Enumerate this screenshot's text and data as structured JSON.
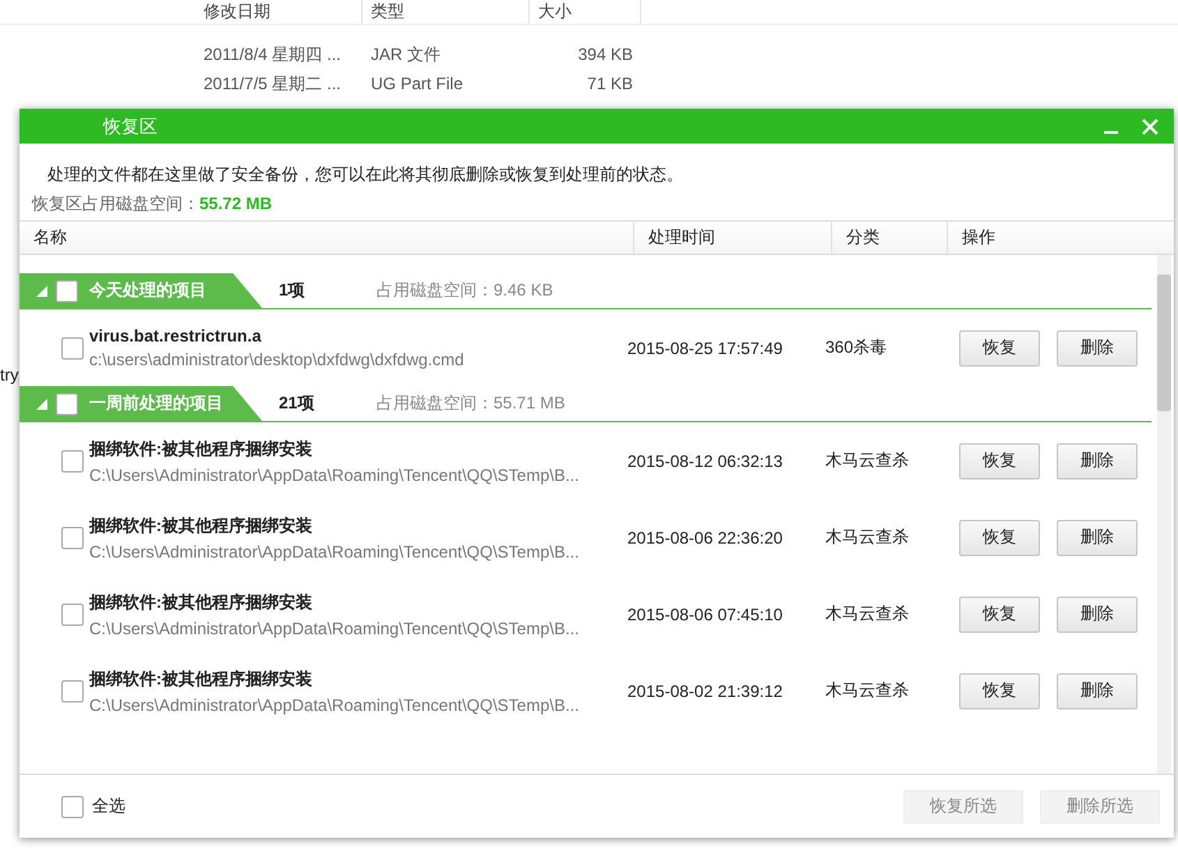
{
  "background_window": {
    "columns": [
      "修改日期",
      "类型",
      "大小"
    ],
    "rows": [
      {
        "date": "2011/8/4 星期四 ...",
        "type": "JAR 文件",
        "size": "394 KB"
      },
      {
        "date": "2011/7/5 星期二 ...",
        "type": "UG Part File",
        "size": "71 KB"
      }
    ],
    "side_fragment": "try"
  },
  "dialog": {
    "title": "恢复区",
    "description": "处理的文件都在这里做了安全备份，您可以在此将其彻底删除或恢复到处理前的状态。",
    "disk_label": "恢复区占用磁盘空间：",
    "disk_value": "55.72 MB",
    "columns": [
      "名称",
      "处理时间",
      "分类",
      "操作"
    ],
    "groups": [
      {
        "title": "今天处理的项目",
        "count": "1项",
        "disk": "占用磁盘空间：9.46 KB",
        "expanded": true,
        "checked": false,
        "items": [
          {
            "name": "virus.bat.restrictrun.a",
            "path": "c:\\users\\administrator\\desktop\\dxfdwg\\dxfdwg.cmd",
            "time": "2015-08-25 17:57:49",
            "category": "360杀毒",
            "checked": false,
            "restore": "恢复",
            "delete": "删除"
          }
        ]
      },
      {
        "title": "一周前处理的项目",
        "count": "21项",
        "disk": "占用磁盘空间：55.71 MB",
        "expanded": true,
        "checked": false,
        "items": [
          {
            "name": "捆绑软件:被其他程序捆绑安装",
            "path": "C:\\Users\\Administrator\\AppData\\Roaming\\Tencent\\QQ\\STemp\\B...",
            "time": "2015-08-12 06:32:13",
            "category": "木马云查杀",
            "checked": false,
            "restore": "恢复",
            "delete": "删除"
          },
          {
            "name": "捆绑软件:被其他程序捆绑安装",
            "path": "C:\\Users\\Administrator\\AppData\\Roaming\\Tencent\\QQ\\STemp\\B...",
            "time": "2015-08-06 22:36:20",
            "category": "木马云查杀",
            "checked": false,
            "restore": "恢复",
            "delete": "删除"
          },
          {
            "name": "捆绑软件:被其他程序捆绑安装",
            "path": "C:\\Users\\Administrator\\AppData\\Roaming\\Tencent\\QQ\\STemp\\B...",
            "time": "2015-08-06 07:45:10",
            "category": "木马云查杀",
            "checked": false,
            "restore": "恢复",
            "delete": "删除"
          },
          {
            "name": "捆绑软件:被其他程序捆绑安装",
            "path": "C:\\Users\\Administrator\\AppData\\Roaming\\Tencent\\QQ\\STemp\\B...",
            "time": "2015-08-02 21:39:12",
            "category": "木马云查杀",
            "checked": false,
            "restore": "恢复",
            "delete": "删除"
          }
        ]
      }
    ],
    "footer": {
      "select_all": "全选",
      "select_all_checked": false,
      "restore_selected": {
        "label": "恢复所选",
        "disabled": true
      },
      "delete_selected": {
        "label": "删除所选",
        "disabled": true
      }
    }
  }
}
